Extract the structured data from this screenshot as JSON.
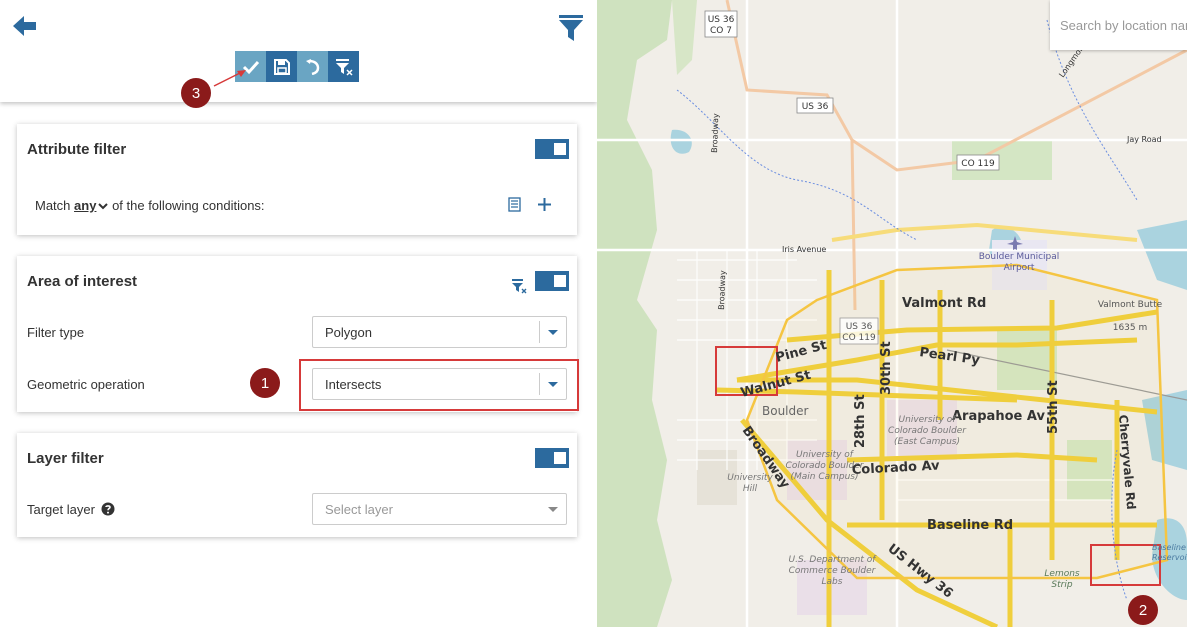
{
  "toolbar": {
    "apply_label": "Apply",
    "save_label": "Save",
    "reset_label": "Reset",
    "clear_label": "Clear filter"
  },
  "callouts": {
    "one": "1",
    "two": "2",
    "three": "3"
  },
  "attribute_filter": {
    "title": "Attribute filter",
    "match_prefix": "Match",
    "match_value": "any",
    "match_suffix": "of the following conditions:"
  },
  "area_of_interest": {
    "title": "Area of interest",
    "filter_type_label": "Filter type",
    "filter_type_value": "Polygon",
    "geometric_operation_label": "Geometric operation",
    "geometric_operation_value": "Intersects"
  },
  "layer_filter": {
    "title": "Layer filter",
    "target_layer_label": "Target layer",
    "target_layer_placeholder": "Select layer"
  },
  "map": {
    "search_placeholder": "Search by location name",
    "labels": {
      "us36_top": "US 36",
      "co7": "CO 7",
      "us36_shield": "US 36",
      "co119": "CO 119",
      "jay_road": "Jay Road",
      "iris_avenue": "Iris Avenue",
      "broadway_north": "Broadway",
      "boulder_municipal": "Boulder Municipal",
      "airport": "Airport",
      "valmont_rd": "Valmont Rd",
      "valmont_butte": "Valmont Butte",
      "valmont_elev": "1635 m",
      "us36_co119_a": "US 36",
      "us36_co119_b": "CO 119",
      "pine_st": "Pine St",
      "pearl_py": "Pearl Py",
      "walnut_st": "Walnut St",
      "thirtieth_st": "30th St",
      "twentyeighth_st": "28th St",
      "fiftyfifth_st": "55th St",
      "arapahoe_av": "Arapahoe Av",
      "boulder": "Boulder",
      "cu_boulder_east": "University of Colorado Boulder (East Campus)",
      "broadway_south": "Broadway",
      "cu_boulder_main": "University of Colorado Boulder (Main Campus)",
      "colorado_av": "Colorado Av",
      "cherryvale_rd": "Cherryvale Rd",
      "university_hill": "University Hill",
      "baseline_rd": "Baseline Rd",
      "us_hwy_36": "US Hwy 36",
      "commerce_labs": "U.S. Department of Commerce Boulder Labs",
      "lemons_strip": "Lemons Strip",
      "baseline_reservoir": "Baseline Reservoir",
      "longmont_diag": "Longmont"
    }
  },
  "colors": {
    "accent": "#2c6a9e",
    "accent_light": "#6aa5c3",
    "callout": "#8b1a1a",
    "highlight_red": "#d63a3a",
    "road_major": "#f5d54a",
    "polygon": "#f5c542"
  }
}
